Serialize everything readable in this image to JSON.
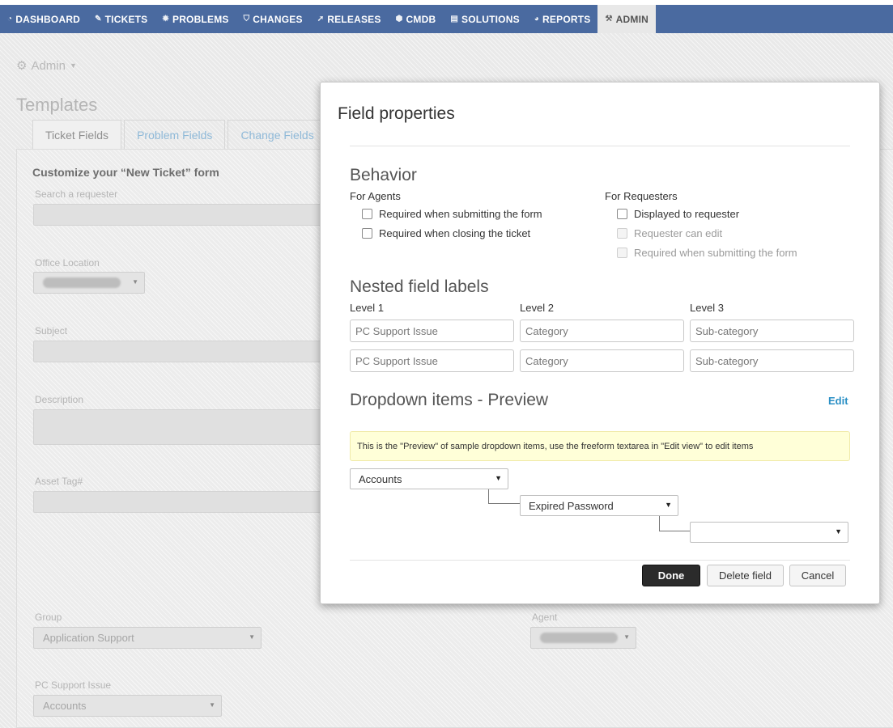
{
  "nav": {
    "items": [
      {
        "label": "DASHBOARD",
        "icon": "dashboard-icon"
      },
      {
        "label": "TICKETS",
        "icon": "ticket-icon"
      },
      {
        "label": "PROBLEMS",
        "icon": "bug-icon"
      },
      {
        "label": "CHANGES",
        "icon": "shield-icon"
      },
      {
        "label": "RELEASES",
        "icon": "rocket-icon"
      },
      {
        "label": "CMDB",
        "icon": "cube-icon"
      },
      {
        "label": "SOLUTIONS",
        "icon": "book-icon"
      },
      {
        "label": "REPORTS",
        "icon": "pie-icon"
      },
      {
        "label": "ADMIN",
        "icon": "tools-icon"
      }
    ],
    "active": "ADMIN"
  },
  "background": {
    "admin_label": "Admin",
    "page_title": "Templates",
    "tabs": [
      "Ticket Fields",
      "Problem Fields",
      "Change Fields"
    ],
    "form_heading": "Customize your “New Ticket” form",
    "fields": {
      "search_requester": "Search a requester",
      "office_location": "Office Location",
      "subject": "Subject",
      "description": "Description",
      "asset_tag": "Asset Tag#",
      "group": "Group",
      "group_value": "Application Support",
      "agent": "Agent",
      "pc_support_issue": "PC Support Issue",
      "pc_support_value": "Accounts"
    }
  },
  "modal": {
    "title": "Field properties",
    "behavior": {
      "heading": "Behavior",
      "agents_label": "For Agents",
      "agents": [
        "Required when submitting the form",
        "Required when closing the ticket"
      ],
      "requesters_label": "For Requesters",
      "requesters": [
        "Displayed to requester",
        "Requester can edit",
        "Required when submitting the form"
      ]
    },
    "nested": {
      "heading": "Nested field labels",
      "levels": [
        "Level 1",
        "Level 2",
        "Level 3"
      ],
      "row1": [
        "PC Support Issue",
        "Category",
        "Sub-category"
      ],
      "row2": [
        "PC Support Issue",
        "Category",
        "Sub-category"
      ]
    },
    "preview": {
      "heading": "Dropdown items - Preview",
      "edit_label": "Edit",
      "note": "This is the \"Preview\" of sample dropdown items, use the freeform textarea in \"Edit view\" to edit items",
      "level1_value": "Accounts",
      "level2_value": "Expired Password",
      "level3_value": ""
    },
    "buttons": {
      "done": "Done",
      "delete": "Delete field",
      "cancel": "Cancel"
    }
  }
}
